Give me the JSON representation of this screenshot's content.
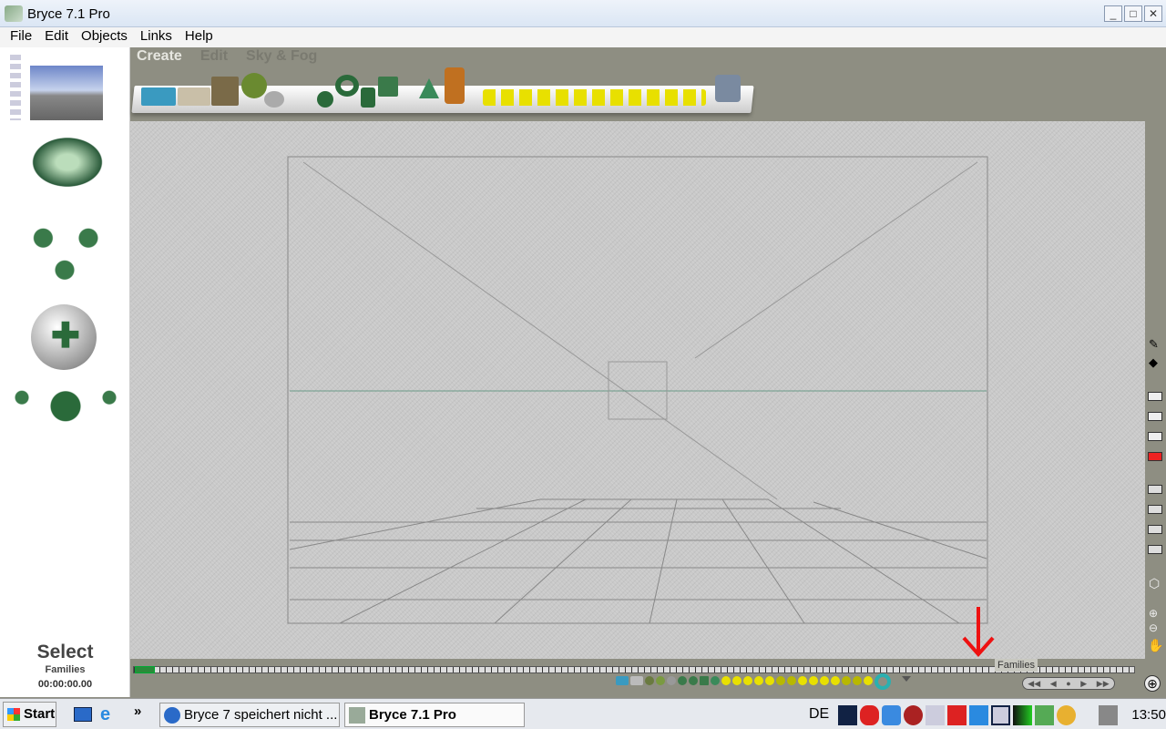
{
  "window": {
    "title": "Bryce 7.1  Pro",
    "controls": [
      "_",
      "□",
      "✕"
    ]
  },
  "menu": [
    "File",
    "Edit",
    "Objects",
    "Links",
    "Help"
  ],
  "palette_tabs": [
    "Create",
    "Edit",
    "Sky & Fog"
  ],
  "active_tab": "Create",
  "status": {
    "mode": "Select",
    "label": "Families",
    "time": "00:00:00.00"
  },
  "tooltip": "Families",
  "anim_controls": [
    "◀◀",
    "◀",
    "●",
    "▶",
    "▶▶"
  ],
  "taskbar": {
    "start": "Start",
    "more": "»",
    "tasks": [
      "Bryce 7 speichert nicht ...",
      "Bryce 7.1  Pro"
    ],
    "lang": "DE",
    "clock": "13:50"
  },
  "colors": {
    "accent_arrow": "#ee1111",
    "selection_green": "#2a8a3a"
  }
}
